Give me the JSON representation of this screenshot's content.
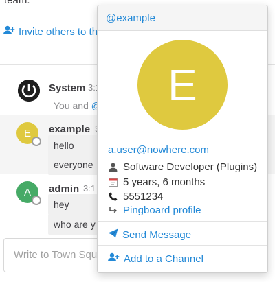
{
  "feed": {
    "intro_text": "team.",
    "invite_link": "Invite others to th",
    "composer_placeholder": "Write to Town Squ"
  },
  "posts": {
    "system": {
      "username": "System",
      "time": "3:1",
      "message_prefix": "You and ",
      "message_mention": "@"
    },
    "example": {
      "username": "example",
      "time": "3",
      "avatar_letter": "E",
      "messages": [
        "hello",
        "everyone"
      ]
    },
    "admin": {
      "username": "admin",
      "time": "3:1",
      "avatar_letter": "A",
      "messages": [
        "hey",
        "who are y"
      ]
    }
  },
  "popover": {
    "handle": "@example",
    "avatar_letter": "E",
    "email": "a.user@nowhere.com",
    "position": "Software Developer (Plugins)",
    "tenure": "5 years, 6 months",
    "phone": "5551234",
    "profile_link": "Pingboard profile",
    "send_message": "Send Message",
    "add_to_channel": "Add to a Channel"
  },
  "colors": {
    "link": "#2389d7",
    "avatar_example": "#dfc93f",
    "avatar_admin": "#46aa66"
  }
}
